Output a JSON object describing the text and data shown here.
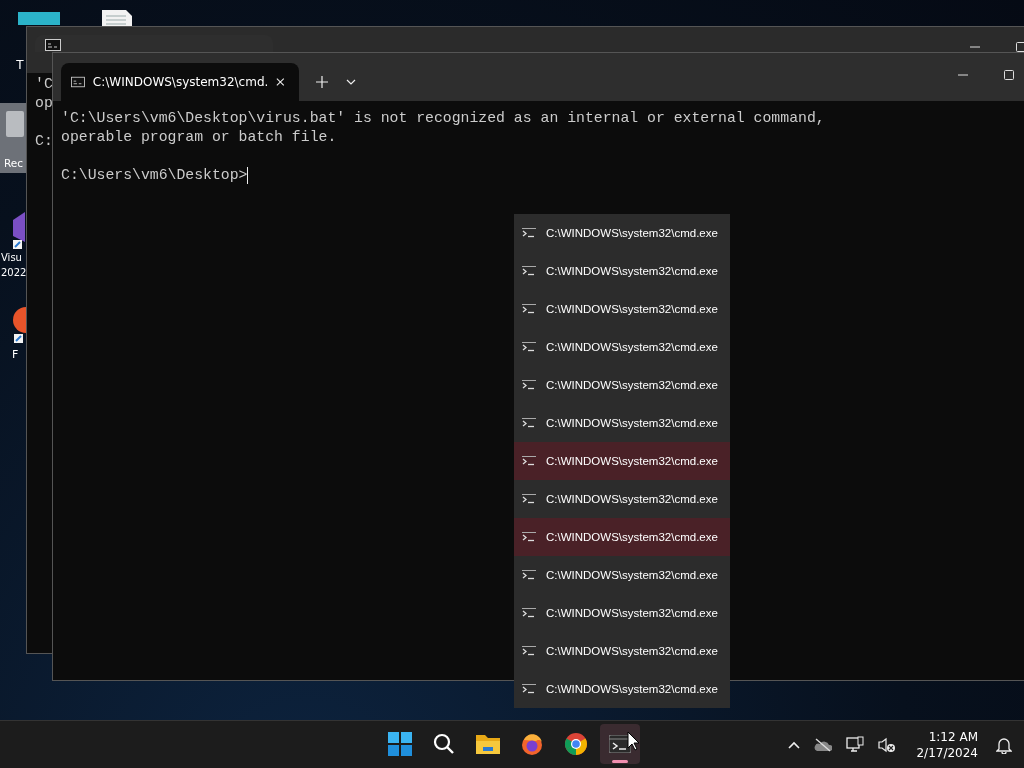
{
  "desktop_icons": [
    {
      "kind": "folder",
      "label": "T"
    },
    {
      "kind": "document"
    },
    {
      "kind": "recycle",
      "label": "Rec"
    },
    {
      "kind": "studio",
      "label": "Visu 2022"
    },
    {
      "kind": "app",
      "label": "F"
    }
  ],
  "back_window": {
    "output_lines": [
      "'C",
      "op"
    ],
    "prompt": "C:"
  },
  "front_window": {
    "tab_title": "C:\\WINDOWS\\system32\\cmd.",
    "output_lines": [
      "'C:\\Users\\vm6\\Desktop\\virus.bat' is not recognized as an internal or external command,",
      "operable program or batch file."
    ],
    "prompt": "C:\\Users\\vm6\\Desktop>"
  },
  "jump_list": [
    {
      "label": "C:\\WINDOWS\\system32\\cmd.exe",
      "selected": false
    },
    {
      "label": "C:\\WINDOWS\\system32\\cmd.exe",
      "selected": false
    },
    {
      "label": "C:\\WINDOWS\\system32\\cmd.exe",
      "selected": false
    },
    {
      "label": "C:\\WINDOWS\\system32\\cmd.exe",
      "selected": false
    },
    {
      "label": "C:\\WINDOWS\\system32\\cmd.exe",
      "selected": false
    },
    {
      "label": "C:\\WINDOWS\\system32\\cmd.exe",
      "selected": false
    },
    {
      "label": "C:\\WINDOWS\\system32\\cmd.exe",
      "selected": true
    },
    {
      "label": "C:\\WINDOWS\\system32\\cmd.exe",
      "selected": false
    },
    {
      "label": "C:\\WINDOWS\\system32\\cmd.exe",
      "selected": true
    },
    {
      "label": "C:\\WINDOWS\\system32\\cmd.exe",
      "selected": false
    },
    {
      "label": "C:\\WINDOWS\\system32\\cmd.exe",
      "selected": false
    },
    {
      "label": "C:\\WINDOWS\\system32\\cmd.exe",
      "selected": false
    },
    {
      "label": "C:\\WINDOWS\\system32\\cmd.exe",
      "selected": false
    }
  ],
  "taskbar": {
    "apps": [
      {
        "kind": "start",
        "selected": false
      },
      {
        "kind": "search",
        "selected": false
      },
      {
        "kind": "explorer",
        "selected": false
      },
      {
        "kind": "firefox",
        "selected": false
      },
      {
        "kind": "chrome",
        "selected": false
      },
      {
        "kind": "terminal",
        "selected": true
      }
    ],
    "time": "1:12 AM",
    "date": "2/17/2024"
  }
}
